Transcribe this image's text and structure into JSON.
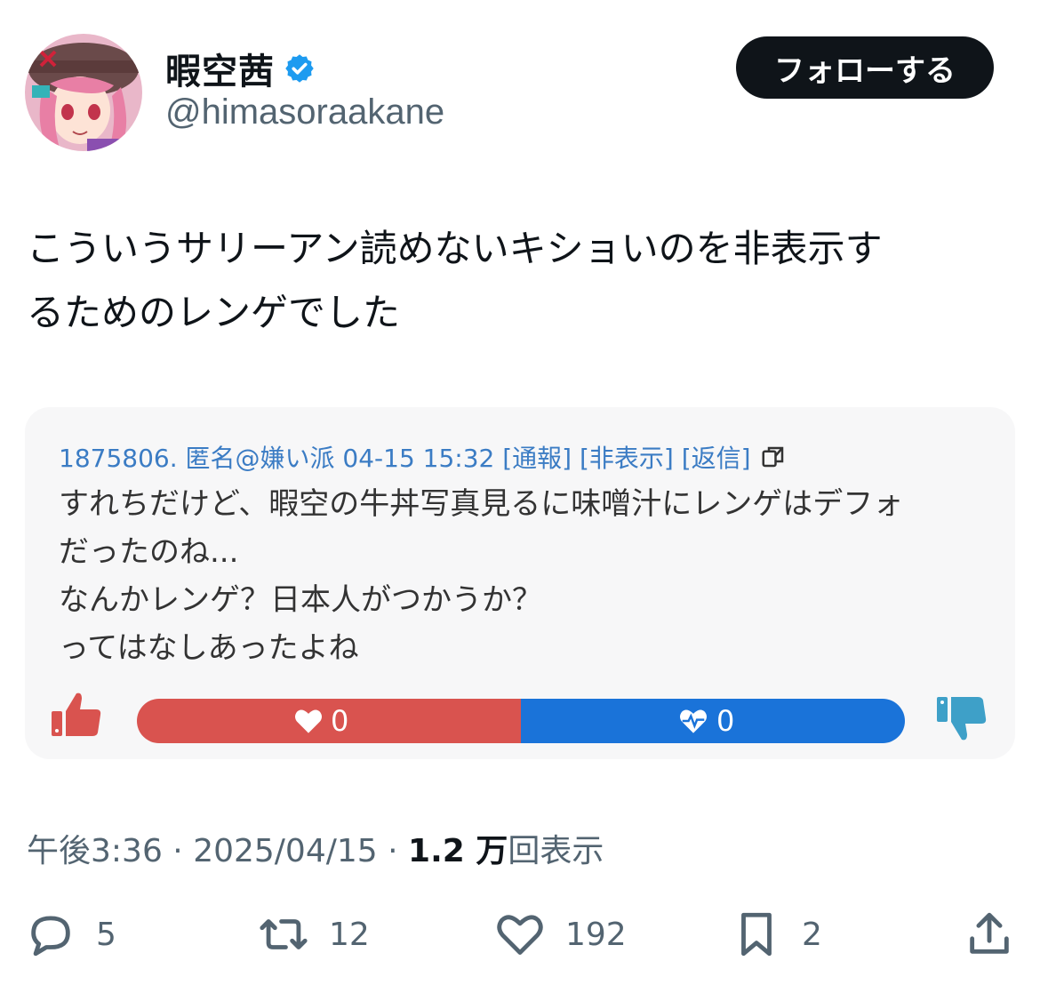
{
  "author": {
    "display_name": "暇空茜",
    "handle": "@himasoraakane",
    "verified": true
  },
  "follow_button": {
    "label": "フォローする"
  },
  "tweet": {
    "lines": [
      "こういうサリーアン読めないキショいのを非表示す",
      "るためのレンゲでした"
    ]
  },
  "quoted_post": {
    "header": "1875806. 匿名@嫌い派 04-15 15:32 [通報] [非表示] [返信]",
    "body_lines": [
      "すれちだけど、暇空の牛丼写真見るに味噌汁にレンゲはデフォ",
      "だったのね...",
      "なんかレンゲ？日本人がつかうか？",
      "ってはなしあったよね"
    ],
    "like_count": "0",
    "dislike_count": "0",
    "like_share": 0.5,
    "colors": {
      "like": "#d9534f",
      "dislike": "#1a73d9",
      "link": "#3b7cc4"
    }
  },
  "meta": {
    "time": "午後3:36",
    "separator": " · ",
    "date": "2025/04/15",
    "views_number": "1.2 万",
    "views_label": "回表示"
  },
  "actions": {
    "replies": "5",
    "retweets": "12",
    "likes": "192",
    "bookmarks": "2"
  },
  "icons": [
    "verified-badge-icon",
    "copy-icon",
    "thumbs-up-icon",
    "heart-icon",
    "heartbeat-icon",
    "thumbs-down-icon",
    "reply-icon",
    "retweet-icon",
    "like-icon",
    "bookmark-icon",
    "share-icon"
  ]
}
